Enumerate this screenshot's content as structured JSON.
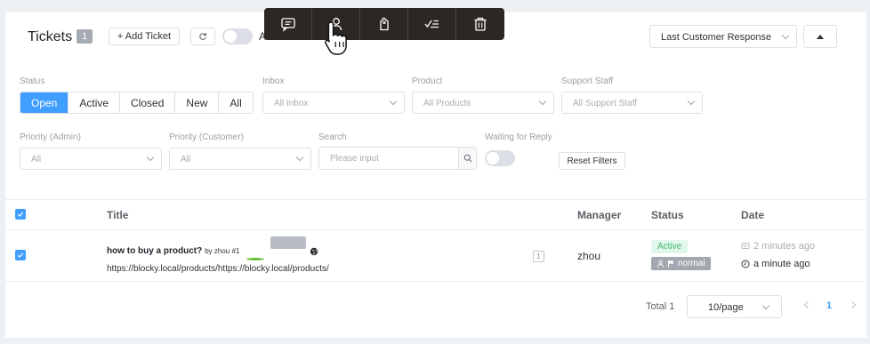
{
  "header": {
    "title": "Tickets",
    "ticket_count": "1",
    "add_ticket_label": "+ Add Ticket",
    "toggle_label": "A",
    "sort_select_value": "Last Customer Response"
  },
  "toolbar": {
    "items": [
      "comment-icon",
      "assign-user-icon",
      "tag-icon",
      "check-list-icon",
      "trash-icon"
    ]
  },
  "filters": {
    "status_label": "Status",
    "status_options": [
      "Open",
      "Active",
      "Closed",
      "New",
      "All"
    ],
    "status_selected": "Open",
    "inbox_label": "Inbox",
    "inbox_placeholder": "All Inbox",
    "product_label": "Product",
    "product_placeholder": "All Products",
    "staff_label": "Support Staff",
    "staff_placeholder": "All Support Staff",
    "priority_admin_label": "Priority (Admin)",
    "priority_admin_value": "All",
    "priority_customer_label": "Priority (Customer)",
    "priority_customer_value": "All",
    "search_label": "Search",
    "search_placeholder": "Please input",
    "waiting_label": "Waiting for Reply",
    "reset_label": "Reset Filters"
  },
  "table": {
    "columns": [
      "Title",
      "Manager",
      "Status",
      "Date"
    ],
    "rows": [
      {
        "title": "how to buy a product?",
        "by": "by zhou #1",
        "url": "https://blocky.local/products/https://blocky.local/products/",
        "reply_count": "1",
        "manager": "zhou",
        "status": "Active",
        "priority": "normal",
        "date_created": "2 minutes ago",
        "date_updated": "a minute ago"
      }
    ]
  },
  "pagination": {
    "total_text": "Total 1",
    "page_size": "10/page",
    "current_page": "1"
  },
  "colors": {
    "accent": "#409eff",
    "toolbar_bg": "#2b2725",
    "active_status_bg": "#e1f7eb",
    "active_status_text": "#3cb371"
  }
}
